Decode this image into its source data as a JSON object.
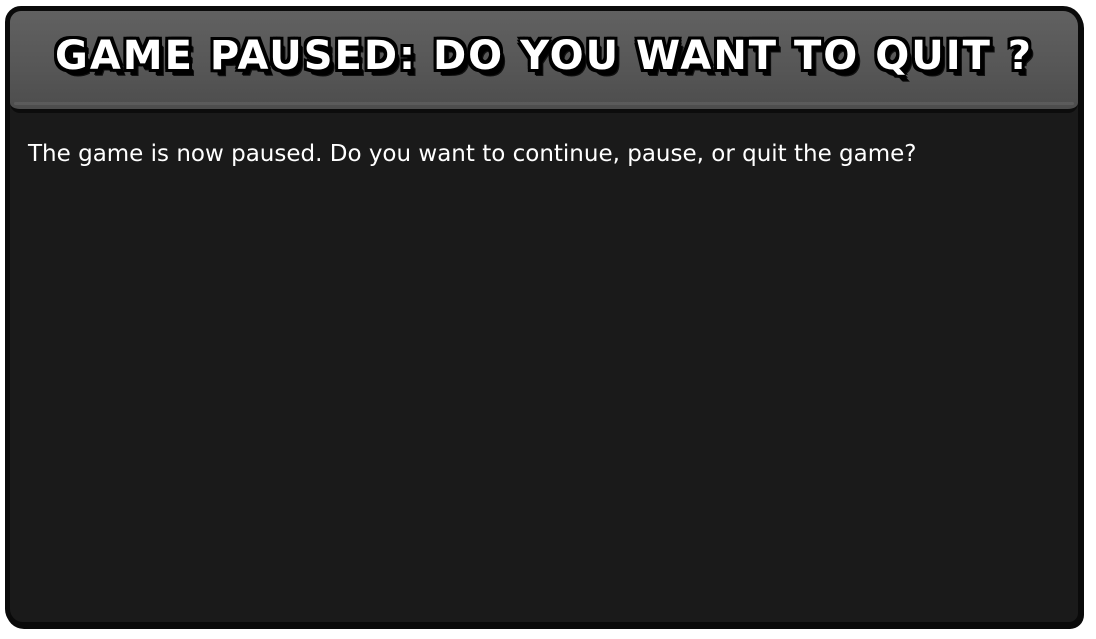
{
  "dialog": {
    "title": "GAME PAUSED: DO YOU WANT TO QUIT ?",
    "message": "The game is now paused. Do you want to continue, pause, or quit the game?"
  },
  "colors": {
    "dialog_background": "#1a1a1a",
    "title_bar_background": "#575757",
    "border": "#0a0a0a",
    "text": "#ffffff"
  }
}
